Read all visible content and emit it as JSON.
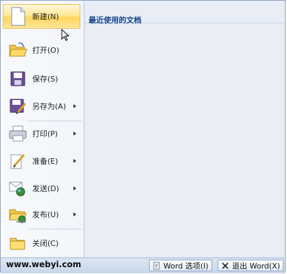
{
  "menu": {
    "items": [
      {
        "label": "新建(N)",
        "icon": "new-document-icon"
      },
      {
        "label": "打开(O)",
        "icon": "open-folder-icon"
      },
      {
        "label": "保存(S)",
        "icon": "save-disk-icon"
      },
      {
        "label": "另存为(A)",
        "icon": "save-as-icon"
      },
      {
        "label": "打印(P)",
        "icon": "printer-icon"
      },
      {
        "label": "准备(E)",
        "icon": "prepare-pen-icon"
      },
      {
        "label": "发送(D)",
        "icon": "send-icon"
      },
      {
        "label": "发布(U)",
        "icon": "publish-folder-icon"
      },
      {
        "label": "关闭(C)",
        "icon": "close-folder-icon"
      }
    ]
  },
  "recent": {
    "title": "最近使用的文档"
  },
  "footer": {
    "watermark": "www.webyi.com",
    "options_label": "Word 选项(I)",
    "exit_label": "退出 Word(X)"
  },
  "colors": {
    "hover_gold": "#ffd75e",
    "header_blue": "#15428b",
    "pane_bg": "#e9eef6"
  }
}
